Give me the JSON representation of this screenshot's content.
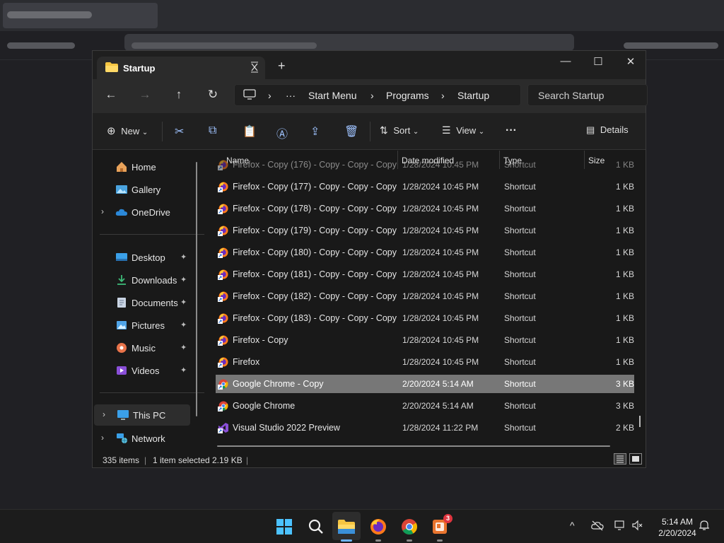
{
  "window": {
    "tab_title": "Startup",
    "new_tab_label": "+",
    "minimize": "—",
    "maximize": "☐",
    "close": "✕"
  },
  "nav": {
    "back": "←",
    "forward": "→",
    "up": "↑",
    "refresh": "↻",
    "address": {
      "more": "···",
      "segments": [
        "Start Menu",
        "Programs",
        "Startup"
      ],
      "separator": "›"
    },
    "search_placeholder": "Search Startup"
  },
  "commands": {
    "new_label": "New",
    "sort_label": "Sort",
    "view_label": "View",
    "more": "···",
    "details_label": "Details"
  },
  "sidebar": {
    "items": [
      {
        "label": "Home",
        "icon": "home-icon"
      },
      {
        "label": "Gallery",
        "icon": "gallery-icon"
      },
      {
        "label": "OneDrive",
        "icon": "cloud-icon",
        "expandable": true
      },
      {
        "label": "Desktop",
        "icon": "desktop-icon",
        "pinned": true
      },
      {
        "label": "Downloads",
        "icon": "download-icon",
        "pinned": true
      },
      {
        "label": "Documents",
        "icon": "document-icon",
        "pinned": true
      },
      {
        "label": "Pictures",
        "icon": "pictures-icon",
        "pinned": true
      },
      {
        "label": "Music",
        "icon": "music-icon",
        "pinned": true
      },
      {
        "label": "Videos",
        "icon": "videos-icon",
        "pinned": true
      },
      {
        "label": "This PC",
        "icon": "computer-icon",
        "expandable": true,
        "selected": true
      },
      {
        "label": "Network",
        "icon": "network-icon",
        "expandable": true
      }
    ],
    "pin_glyph": "📌",
    "chevron": "›"
  },
  "columns": {
    "name": "Name",
    "date": "Date modified",
    "type": "Type",
    "size": "Size"
  },
  "files": [
    {
      "name": "Firefox - Copy (176) - Copy - Copy - Copy",
      "date": "1/28/2024 10:45 PM",
      "type": "Shortcut",
      "size": "1 KB",
      "icon": "firefox"
    },
    {
      "name": "Firefox - Copy (177) - Copy - Copy - Copy",
      "date": "1/28/2024 10:45 PM",
      "type": "Shortcut",
      "size": "1 KB",
      "icon": "firefox"
    },
    {
      "name": "Firefox - Copy (178) - Copy - Copy - Copy",
      "date": "1/28/2024 10:45 PM",
      "type": "Shortcut",
      "size": "1 KB",
      "icon": "firefox"
    },
    {
      "name": "Firefox - Copy (179) - Copy - Copy - Copy",
      "date": "1/28/2024 10:45 PM",
      "type": "Shortcut",
      "size": "1 KB",
      "icon": "firefox"
    },
    {
      "name": "Firefox - Copy (180) - Copy - Copy - Copy",
      "date": "1/28/2024 10:45 PM",
      "type": "Shortcut",
      "size": "1 KB",
      "icon": "firefox"
    },
    {
      "name": "Firefox - Copy (181) - Copy - Copy - Copy",
      "date": "1/28/2024 10:45 PM",
      "type": "Shortcut",
      "size": "1 KB",
      "icon": "firefox"
    },
    {
      "name": "Firefox - Copy (182) - Copy - Copy - Copy",
      "date": "1/28/2024 10:45 PM",
      "type": "Shortcut",
      "size": "1 KB",
      "icon": "firefox"
    },
    {
      "name": "Firefox - Copy (183) - Copy - Copy - Copy",
      "date": "1/28/2024 10:45 PM",
      "type": "Shortcut",
      "size": "1 KB",
      "icon": "firefox"
    },
    {
      "name": "Firefox - Copy",
      "date": "1/28/2024 10:45 PM",
      "type": "Shortcut",
      "size": "1 KB",
      "icon": "firefox"
    },
    {
      "name": "Firefox",
      "date": "1/28/2024 10:45 PM",
      "type": "Shortcut",
      "size": "1 KB",
      "icon": "firefox"
    },
    {
      "name": "Google Chrome - Copy",
      "date": "2/20/2024 5:14 AM",
      "type": "Shortcut",
      "size": "3 KB",
      "icon": "chrome",
      "selected": true
    },
    {
      "name": "Google Chrome",
      "date": "2/20/2024 5:14 AM",
      "type": "Shortcut",
      "size": "3 KB",
      "icon": "chrome"
    },
    {
      "name": "Visual Studio 2022 Preview",
      "date": "1/28/2024 11:22 PM",
      "type": "Shortcut",
      "size": "2 KB",
      "icon": "visual-studio"
    }
  ],
  "status": {
    "item_count": "335 items",
    "selection": "1 item selected",
    "selection_size": "2.19 KB",
    "divider": "|"
  },
  "taskbar": {
    "apps": [
      "start-icon",
      "search-icon",
      "file-explorer-icon",
      "firefox-icon",
      "chrome-icon",
      "presentation-app-icon"
    ],
    "badge_count": "3",
    "tray": {
      "chevron": "^"
    },
    "clock_time": "5:14 AM",
    "clock_date": "2/20/2024"
  },
  "colors": {
    "accent": "#6cb4ff",
    "selection": "#777777",
    "badge": "#e0353f"
  }
}
